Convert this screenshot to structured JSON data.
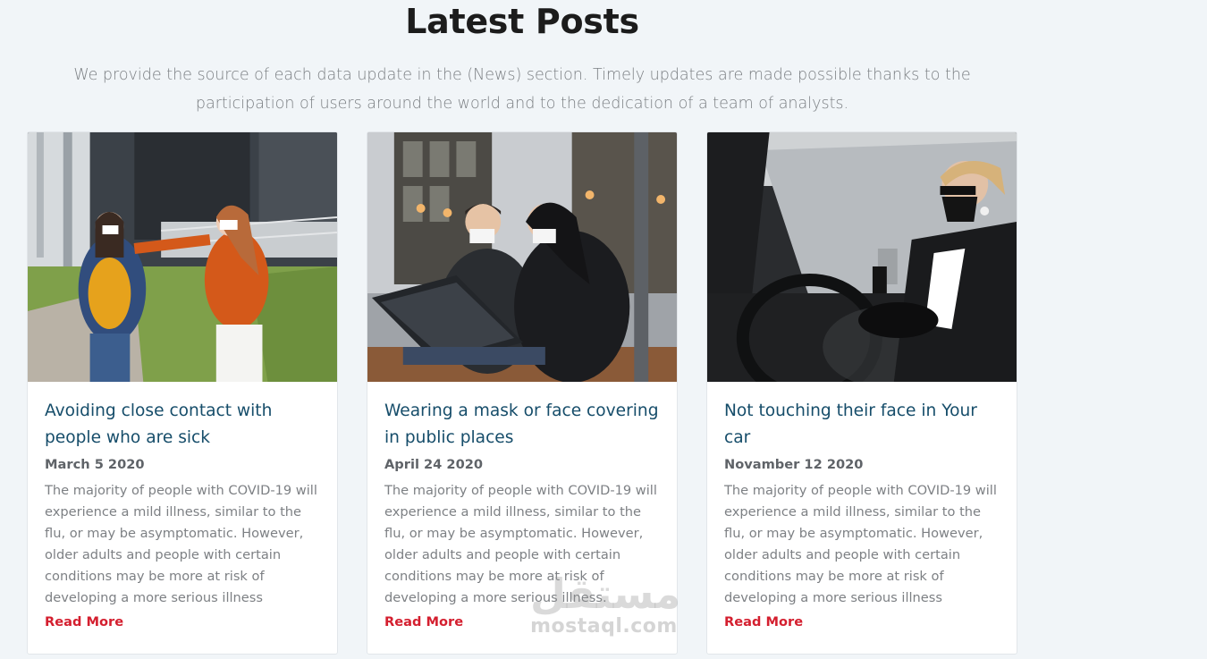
{
  "section": {
    "title": "Latest Posts",
    "intro": "We provide the source of each data update in the (News) section. Timely updates are made possible thanks to the participation of users around the world and to the dedication of a team of analysts."
  },
  "posts": [
    {
      "title": "Avoiding close contact with people who are sick",
      "date": "March 5 2020",
      "excerpt": "The majority of people with COVID-19 will experience a mild illness, similar to the flu, or may be asymptomatic. However, older adults and people with certain conditions may be more at risk of developing a more serious illness",
      "link": "Read More"
    },
    {
      "title": "Wearing a mask or face covering in public places",
      "date": "April 24 2020",
      "excerpt": "The majority of people with COVID-19 will experience a mild illness, similar to the flu, or may be asymptomatic. However, older adults and people with certain conditions may be more at risk of developing a more serious illness.",
      "link": "Read More"
    },
    {
      "title": "Not touching their face in Your car",
      "date": "Novamber 12 2020",
      "excerpt": "The majority of people with COVID-19 will experience a mild illness, similar to the flu, or may be asymptomatic. However, older adults and people with certain conditions may be more at risk of developing a more serious illness",
      "link": "Read More"
    }
  ],
  "watermark": {
    "arabic": "مستقل",
    "latin": "mostaql.com"
  }
}
